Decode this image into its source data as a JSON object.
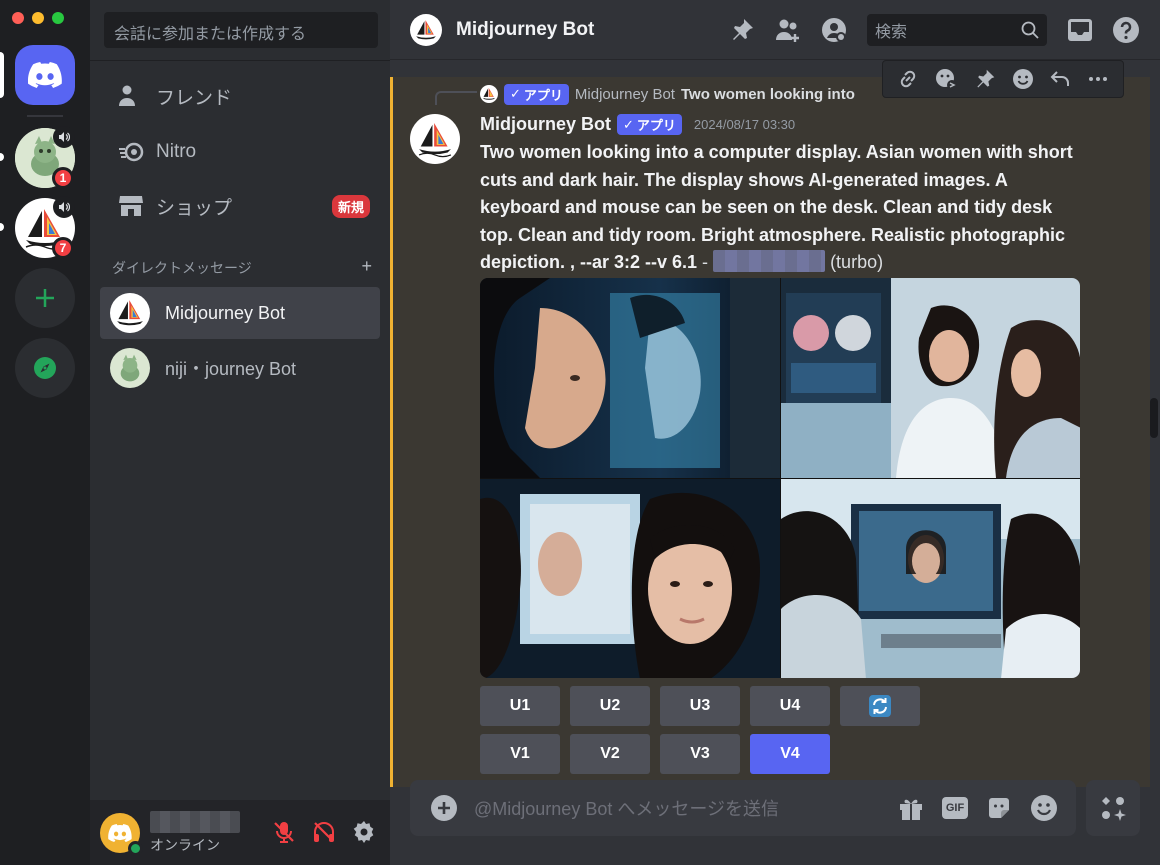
{
  "sidebar": {
    "search_placeholder": "会話に参加または作成する",
    "nav": {
      "friends": "フレンド",
      "nitro": "Nitro",
      "shop": "ショップ",
      "shop_badge": "新規"
    },
    "dm_header": "ダイレクトメッセージ",
    "dm_add": "+",
    "dms": [
      "Midjourney Bot",
      "niji・journey Bot"
    ]
  },
  "servers": {
    "badge1": "1",
    "badge2": "7"
  },
  "user": {
    "status": "オンライン"
  },
  "header": {
    "title": "Midjourney Bot",
    "search_placeholder": "検索"
  },
  "message": {
    "reply_author": "Midjourney Bot",
    "reply_app_tag": "アプリ",
    "reply_text": "Two women looking into",
    "author": "Midjourney Bot",
    "app_tag": "アプリ",
    "timestamp": "2024/08/17 03:30",
    "prompt": "Two women looking into a computer display. Asian women with short cuts and dark hair. The display shows AI-generated images. A keyboard and mouse can be seen on the desk. Clean and tidy desk top. Clean and tidy room. Bright atmosphere. Realistic photographic depiction. , --ar 3:2 --v 6.1",
    "dash": " - ",
    "mode": "(turbo)"
  },
  "buttons": {
    "row1": [
      "U1",
      "U2",
      "U3",
      "U4"
    ],
    "row2": [
      "V1",
      "V2",
      "V3",
      "V4"
    ],
    "active": "V4"
  },
  "composer": {
    "placeholder": "@Midjourney Bot へメッセージを送信",
    "gif": "GIF"
  },
  "colors": {
    "blurple": "#5865f2",
    "highlight_bar": "#f0b232",
    "badge_red": "#f23f43",
    "online_green": "#23a55a"
  }
}
